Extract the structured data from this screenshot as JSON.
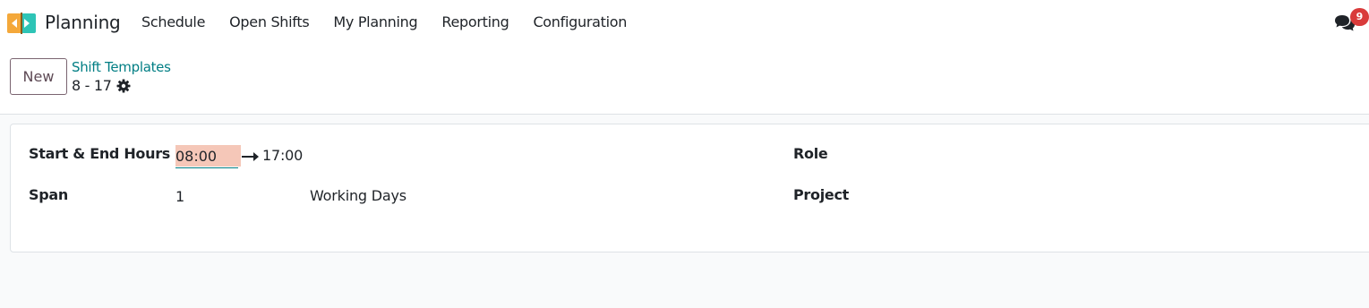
{
  "app": {
    "name": "Planning",
    "logo_icon": "planning-app-icon",
    "colors": {
      "orange": "#f4a83a",
      "teal": "#2ec4b6",
      "dark": "#1f2328"
    }
  },
  "navbar": {
    "menu": [
      {
        "label": "Schedule"
      },
      {
        "label": "Open Shifts"
      },
      {
        "label": "My Planning"
      },
      {
        "label": "Reporting"
      },
      {
        "label": "Configuration"
      }
    ],
    "messages": {
      "icon": "chat-bubbles-icon",
      "count": "9",
      "badge_color": "#d93b3b"
    }
  },
  "control_panel": {
    "new_label": "New",
    "breadcrumb": "Shift Templates",
    "record_title": "8 - 17",
    "settings_icon": "gear-icon",
    "accent": "#017e84"
  },
  "form": {
    "hours_label": "Start & End Hours",
    "start_time": "08:00",
    "end_time": "17:00",
    "span_label": "Span",
    "span_value": "1",
    "span_unit": "Working Days",
    "role_label": "Role",
    "project_label": "Project"
  }
}
